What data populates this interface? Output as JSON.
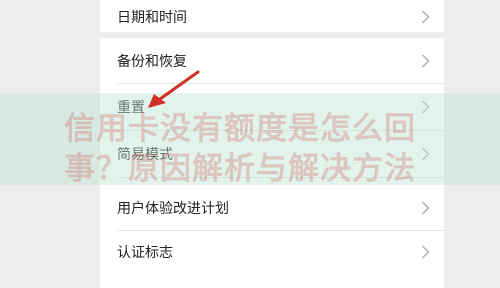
{
  "settings": {
    "items": [
      {
        "label": "日期和时间"
      },
      {
        "label": "备份和恢复"
      },
      {
        "label": "重置"
      },
      {
        "label": "简易模式"
      },
      {
        "label": "用户体验改进计划"
      },
      {
        "label": "认证标志"
      }
    ]
  },
  "watermark": {
    "line1": "信用卡没有额度是怎么回",
    "line2": "事？原因解析与解决方法"
  },
  "colors": {
    "annotation_arrow": "#d0302a",
    "background": "#ededed",
    "card": "#ffffff"
  }
}
